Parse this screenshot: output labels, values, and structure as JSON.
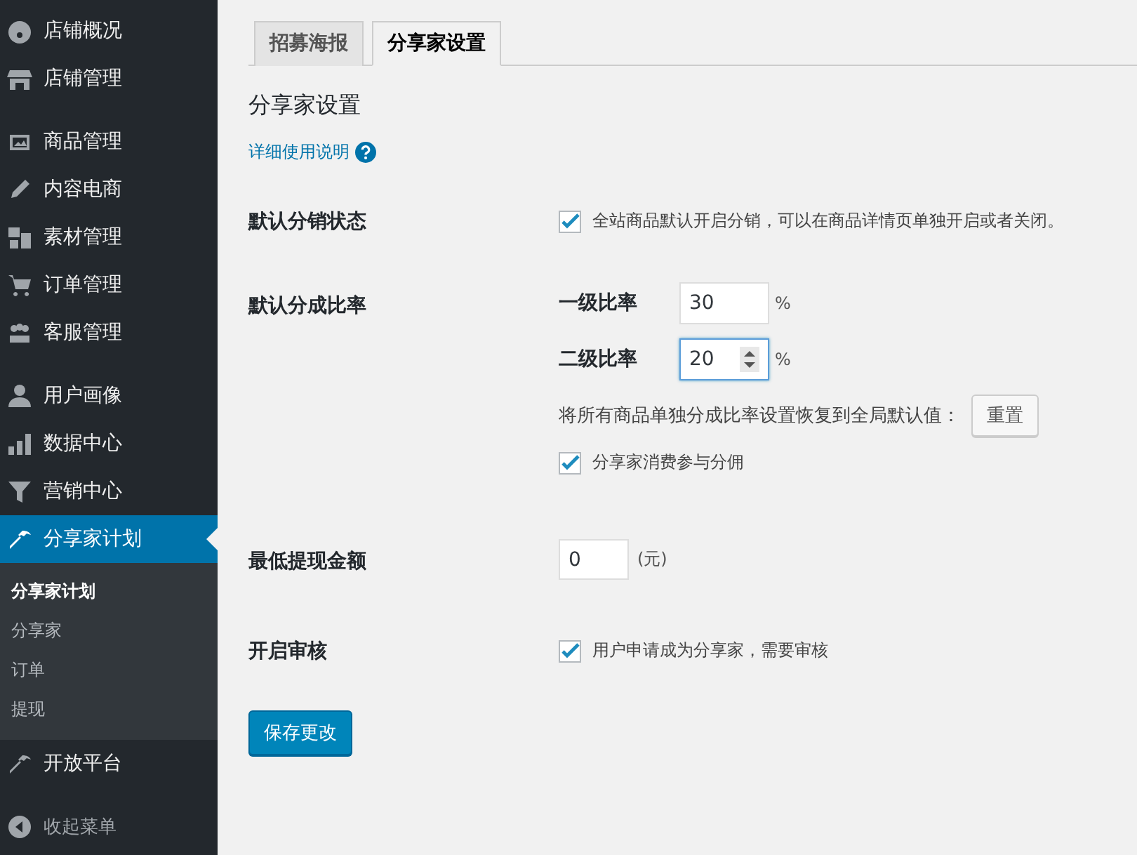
{
  "sidebar": {
    "groups": [
      [
        {
          "label": "店铺概况",
          "selected": false
        },
        {
          "label": "店铺管理",
          "selected": false
        }
      ],
      [
        {
          "label": "商品管理",
          "selected": false
        },
        {
          "label": "内容电商",
          "selected": false
        },
        {
          "label": "素材管理",
          "selected": false
        },
        {
          "label": "订单管理",
          "selected": false
        },
        {
          "label": "客服管理",
          "selected": false
        }
      ],
      [
        {
          "label": "用户画像",
          "selected": false
        },
        {
          "label": "数据中心",
          "selected": false
        },
        {
          "label": "营销中心",
          "selected": false
        },
        {
          "label": "分享家计划",
          "selected": true,
          "submenu": [
            {
              "label": "分享家计划",
              "selected": true
            },
            {
              "label": "分享家",
              "selected": false
            },
            {
              "label": "订单",
              "selected": false
            },
            {
              "label": "提现",
              "selected": false
            }
          ]
        },
        {
          "label": "开放平台",
          "selected": false
        }
      ]
    ],
    "collapse": "收起菜单"
  },
  "tabs": [
    {
      "label": "招募海报",
      "selected": false
    },
    {
      "label": "分享家设置",
      "selected": true
    }
  ],
  "heading": "分享家设置",
  "help_link": "详细使用说明",
  "settings": [
    {
      "kind": "checkbox",
      "label": "默认分销状态",
      "checked": true,
      "text": "全站商品默认开启分销，可以在商品详情页单独开启或者关闭。"
    },
    {
      "kind": "rates",
      "label": "默认分成比率",
      "fields": [
        {
          "label": "一级比率",
          "value": "30",
          "unit": "%",
          "focused": false
        },
        {
          "label": "二级比率",
          "value": "20",
          "unit": "%",
          "focused": true
        }
      ],
      "reset_text": "将所有商品单独分成比率设置恢复到全局默认值：",
      "reset_button": "重置",
      "option": {
        "checked": true,
        "text": "分享家消费参与分佣"
      }
    },
    {
      "kind": "amount",
      "label": "最低提现金额",
      "value": "0",
      "unit": "(元)"
    },
    {
      "kind": "checkbox",
      "label": "开启审核",
      "checked": true,
      "text": "用户申请成为分享家，需要审核"
    }
  ],
  "save_button": "保存更改"
}
